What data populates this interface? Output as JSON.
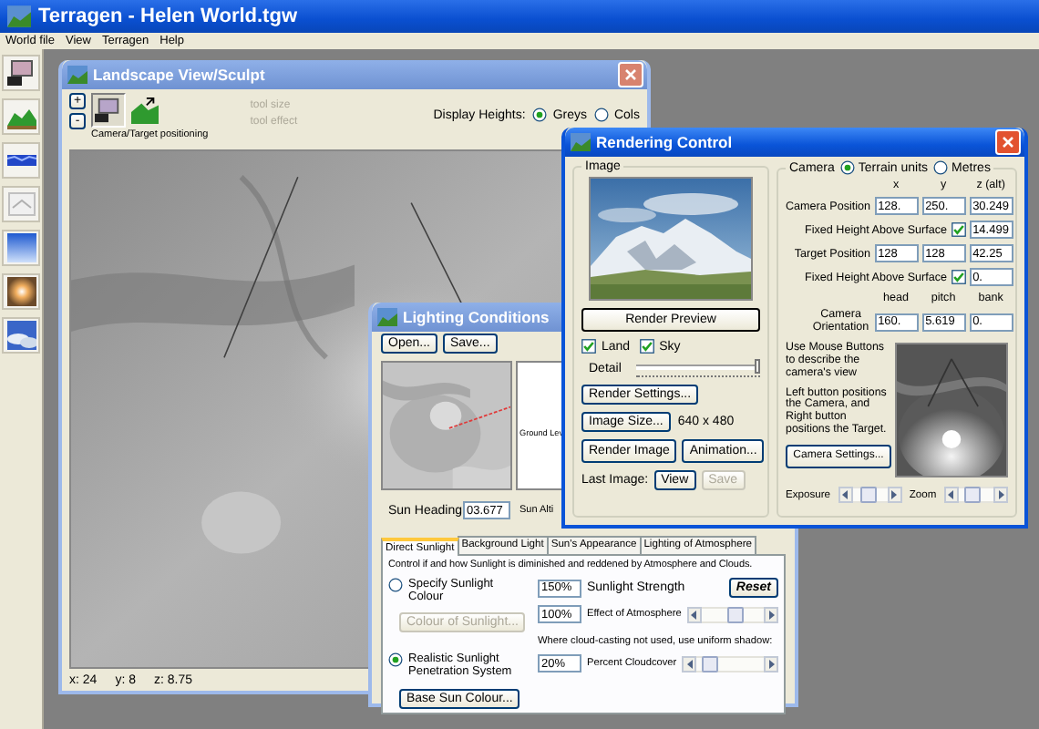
{
  "app": {
    "title": "Terragen - Helen World.tgw"
  },
  "menu": [
    "World file",
    "View",
    "Terragen",
    "Help"
  ],
  "landscape_window": {
    "title": "Landscape View/Sculpt",
    "active": false,
    "zoom_buttons": [
      "+",
      "-"
    ],
    "tools": [
      {
        "kind": "camera",
        "selected": true
      },
      {
        "kind": "sculpt",
        "selected": false
      }
    ],
    "tool_label": "Camera/Target positioning",
    "tool_settings": [
      {
        "label": "tool size",
        "disabled": true
      },
      {
        "label": "tool effect",
        "disabled": true
      }
    ],
    "display_heights": {
      "label": "Display Heights:",
      "options": [
        {
          "label": "Greys",
          "selected": true
        },
        {
          "label": "Cols",
          "selected": false
        }
      ]
    },
    "status": [
      "x: 24",
      "y: 8",
      "z: 8.75"
    ]
  },
  "lighting_window": {
    "title": "Lighting Conditions",
    "active": false,
    "buttons": [
      "Open...",
      "Save..."
    ],
    "ground_label": "Ground Lev",
    "sun_heading": {
      "label": "Sun Heading",
      "value": "03.677"
    },
    "sun_altitude_label": "Sun Alti",
    "tabs": [
      {
        "label": "Direct Sunlight",
        "selected": true
      },
      {
        "label": "Background Light",
        "selected": false
      },
      {
        "label": "Sun's Appearance",
        "selected": false
      },
      {
        "label": "Lighting of Atmosphere",
        "selected": false
      }
    ],
    "description": "Control if and how Sunlight is diminished and reddened by Atmosphere and Clouds.",
    "sunlight_modes": [
      {
        "label": "Specify Sunlight Colour",
        "selected": false,
        "button": {
          "label": "Colour of Sunlight...",
          "disabled": true
        }
      },
      {
        "label": "Realistic Sunlight Penetration System",
        "selected": true,
        "button": {
          "label": "Base Sun Colour...",
          "disabled": false
        }
      }
    ],
    "strength": {
      "value": "150%",
      "label": "Sunlight Strength"
    },
    "reset": "Reset",
    "atmosphere": {
      "value": "100%",
      "label": "Effect of Atmosphere",
      "level": 0.55
    },
    "cloud_note": "Where cloud-casting not used, use uniform shadow:",
    "cloudcover": {
      "value": "20%",
      "label": "Percent Cloudcover",
      "level": 0.12
    }
  },
  "rendering_window": {
    "title": "Rendering Control",
    "active": true,
    "image_group": "Image",
    "render_preview": "Render Preview",
    "land": {
      "label": "Land",
      "checked": true
    },
    "sky": {
      "label": "Sky",
      "checked": true
    },
    "detail": {
      "label": "Detail",
      "level": 1.0
    },
    "render_settings": "Render Settings...",
    "image_size": {
      "button": "Image Size...",
      "value": "640 x 480"
    },
    "render_image": "Render Image",
    "animation": "Animation...",
    "last_image": {
      "label": "Last Image:",
      "view": {
        "label": "View",
        "disabled": false
      },
      "save": {
        "label": "Save",
        "disabled": true
      }
    },
    "camera": {
      "group": "Camera",
      "units": [
        {
          "label": "Terrain units",
          "selected": true
        },
        {
          "label": "Metres",
          "selected": false
        }
      ],
      "columns": [
        "x",
        "y",
        "z (alt)"
      ],
      "camera_position": {
        "label": "Camera Position",
        "values": [
          "128.",
          "250.",
          "30.249"
        ]
      },
      "camera_fixed": {
        "label": "Fixed Height Above Surface",
        "checked": true,
        "value": "14.499"
      },
      "target_position": {
        "label": "Target Position",
        "values": [
          "128",
          "128",
          "42.25"
        ]
      },
      "target_fixed": {
        "label": "Fixed Height Above Surface",
        "checked": true,
        "value": "0."
      },
      "orientation_columns": [
        "head",
        "pitch",
        "bank"
      ],
      "orientation": {
        "label": "Camera Orientation",
        "values": [
          "160.",
          "5.619",
          "0."
        ]
      },
      "help": "Use Mouse Buttons to describe the camera's view",
      "help2": "Left button positions the Camera, and Right button positions the Target.",
      "camera_settings": "Camera Settings...",
      "exposure": {
        "label": "Exposure",
        "level": 0.45
      },
      "zoom": {
        "label": "Zoom",
        "level": 0.3
      }
    }
  }
}
